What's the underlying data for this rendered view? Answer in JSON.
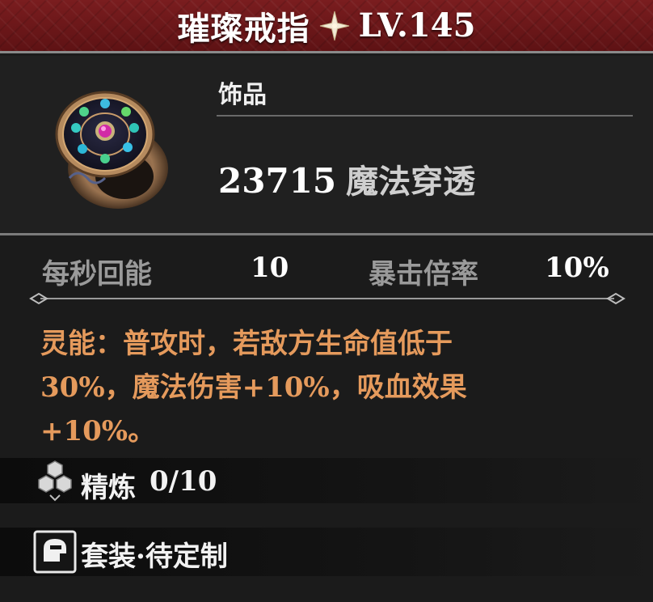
{
  "header": {
    "title": "璀璨戒指",
    "level": "LV.145",
    "star_icon": "four-point-star-icon"
  },
  "item": {
    "icon": "jeweled-ring-icon",
    "category": "饰品",
    "main_value": "23715",
    "main_label": "魔法穿透"
  },
  "stats": [
    {
      "name": "每秒回能",
      "value": "10"
    },
    {
      "name": "暴击倍率",
      "value": "10%"
    }
  ],
  "effect": {
    "lines": [
      "灵能：普攻时，若敌方生命值低于",
      "30%，魔法伤害+10%，吸血效果",
      "+10%。"
    ]
  },
  "refine": {
    "icon": "hexagon-cluster-icon",
    "label": "精炼",
    "value": "0/10"
  },
  "set": {
    "icon": "helmet-icon",
    "label": "套装·待定制"
  },
  "colors": {
    "header_red": "#6e181a",
    "effect_orange": "#e59a5c",
    "stat_gray": "#9a9a9a",
    "background": "#1b1b1b"
  }
}
